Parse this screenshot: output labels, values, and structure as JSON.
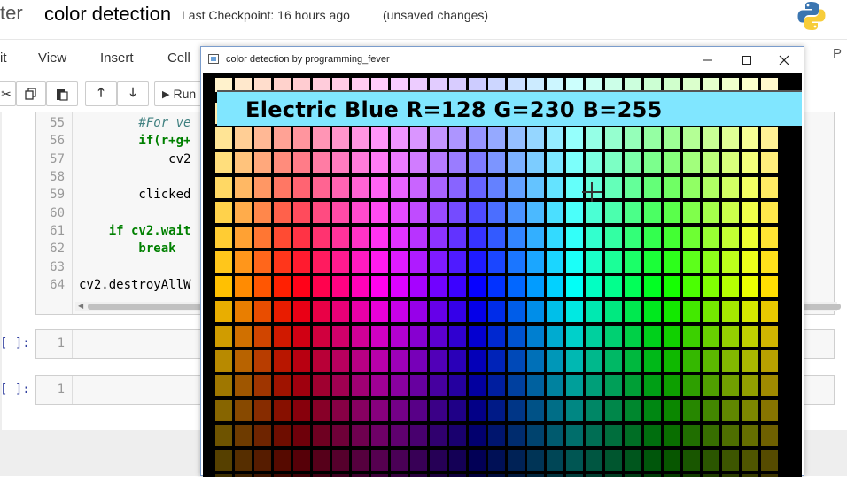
{
  "header": {
    "logo_fragment": "ter",
    "notebook_title": "color detection",
    "checkpoint": "Last Checkpoint: 16 hours ago",
    "unsaved": "(unsaved changes)"
  },
  "menu": {
    "items": [
      "it",
      "View",
      "Insert",
      "Cell"
    ],
    "right_fragment": "P"
  },
  "toolbar": {
    "run_label": "Run"
  },
  "code_cell": {
    "lines": [
      {
        "num": "55",
        "text": "        #For ve"
      },
      {
        "num": "56",
        "text": "        if(r+g+"
      },
      {
        "num": "57",
        "text": "            cv2"
      },
      {
        "num": "58",
        "text": ""
      },
      {
        "num": "59",
        "text": "        clicked"
      },
      {
        "num": "60",
        "text": ""
      },
      {
        "num": "61",
        "text": "    if cv2.wait"
      },
      {
        "num": "62",
        "text": "        break"
      },
      {
        "num": "63",
        "text": ""
      },
      {
        "num": "64",
        "text": "cv2.destroyAllW"
      }
    ]
  },
  "empty_cells": [
    {
      "prompt": "[ ]:",
      "line": "1"
    },
    {
      "prompt": "[ ]:",
      "line": "1"
    }
  ],
  "cv_window": {
    "title": "color detection by programming_fever",
    "minimize_icon": "minimize-icon",
    "maximize_icon": "maximize-icon",
    "close_icon": "close-icon",
    "detected_text": "Electric Blue R=128 G=230 B=255",
    "banner_color": "#80e6ff"
  },
  "colors": {
    "link_blue": "#303f9f",
    "window_border": "#7a9ccc"
  }
}
